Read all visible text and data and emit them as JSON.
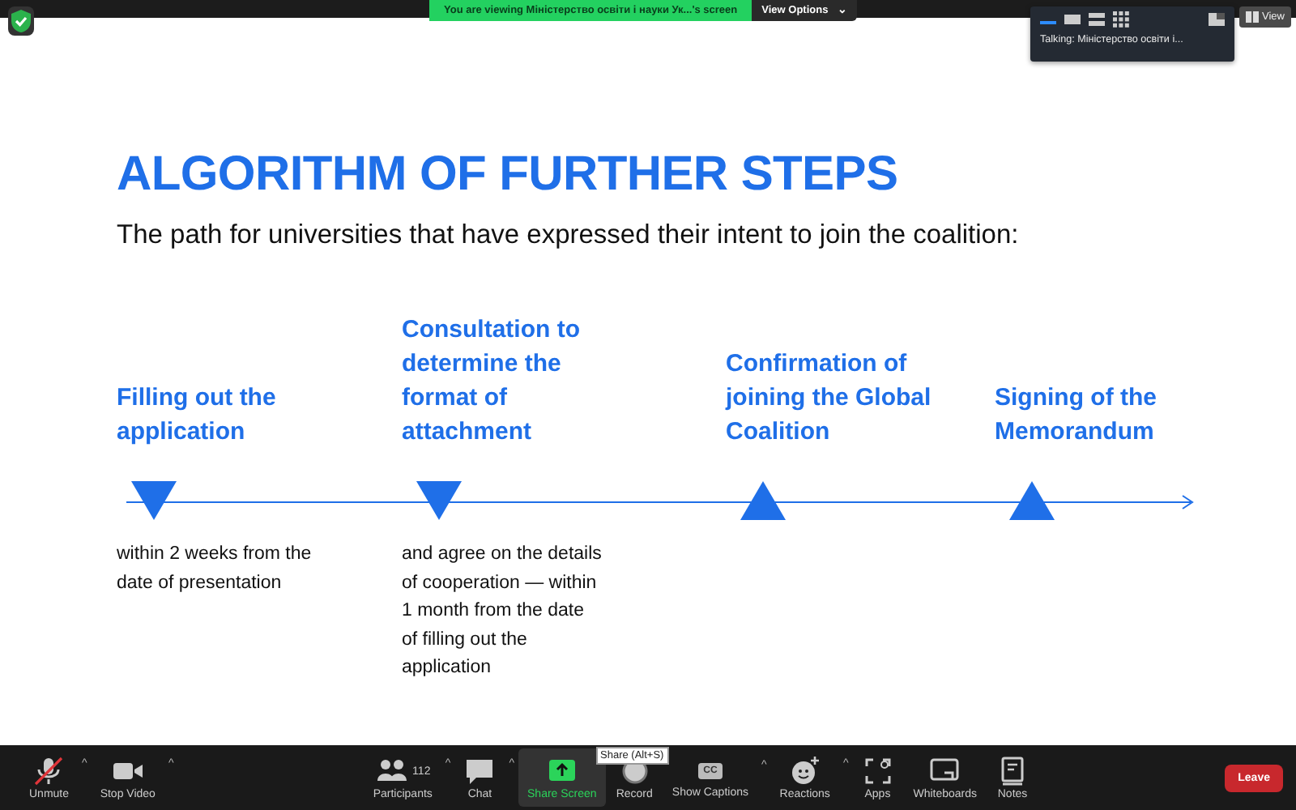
{
  "banner": {
    "text": "You are viewing Міністерство освіти і науки Ук...'s screen",
    "button": "View Options",
    "caret": "⌄"
  },
  "talking_panel": {
    "text": "Talking: Міністерство освіти і..."
  },
  "view_button": {
    "label": "View"
  },
  "slide": {
    "title": "ALGORITHM OF FURTHER STEPS",
    "subtitle": "The path for universities that have expressed their intent to join the coalition:",
    "steps": [
      {
        "label": "Filling out the application",
        "kind": "down",
        "note": "within 2 weeks from the date of presentation"
      },
      {
        "label": "Consultation to determine the format of attachment",
        "kind": "down",
        "note": "and agree on the details of cooperation — within 1 month from the date of filling out the application"
      },
      {
        "label": "Confirmation of joining the Global Coalition",
        "kind": "up"
      },
      {
        "label": "Signing of the Memorandum",
        "kind": "up"
      }
    ]
  },
  "tooltip": {
    "text": "Share (Alt+S)"
  },
  "toolbar": [
    {
      "kind": "mic-muted",
      "label": "Unmute",
      "caret": "^",
      "selected": false
    },
    {
      "kind": "camera",
      "label": "Stop Video",
      "caret": "^",
      "selected": false
    },
    {
      "kind": "spacer"
    },
    {
      "kind": "people",
      "label": "Participants",
      "count": "112",
      "caret": "^",
      "selected": false
    },
    {
      "kind": "chat",
      "label": "Chat",
      "caret": "^",
      "selected": false
    },
    {
      "kind": "share",
      "label": "Share Screen",
      "selected": true
    },
    {
      "kind": "record",
      "label": "Record",
      "selected": false
    },
    {
      "kind": "cc",
      "label": "Show Captions",
      "badge": "CC",
      "caret": "^",
      "selected": false
    },
    {
      "kind": "reactions",
      "label": "Reactions",
      "caret": "^",
      "selected": false
    },
    {
      "kind": "apps",
      "label": "Apps",
      "selected": false
    },
    {
      "kind": "whiteboard",
      "label": "Whiteboards",
      "selected": false
    },
    {
      "kind": "notes",
      "label": "Notes",
      "selected": false
    },
    {
      "kind": "spacer"
    },
    {
      "kind": "leave",
      "label": "Leave"
    }
  ]
}
